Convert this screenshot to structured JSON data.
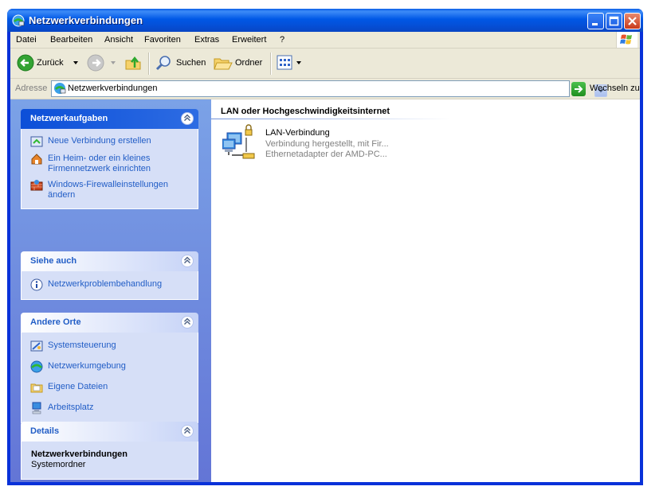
{
  "window": {
    "title": "Netzwerkverbindungen"
  },
  "menubar": {
    "items": [
      "Datei",
      "Bearbeiten",
      "Ansicht",
      "Favoriten",
      "Extras",
      "Erweitert",
      "?"
    ]
  },
  "toolbar": {
    "back_label": "Zurück",
    "search_label": "Suchen",
    "folders_label": "Ordner"
  },
  "addressbar": {
    "label": "Adresse",
    "value": "Netzwerkverbindungen",
    "go_label": "Wechseln zu"
  },
  "sidebar": {
    "network_tasks": {
      "title": "Netzwerkaufgaben",
      "items": [
        {
          "label": "Neue Verbindung erstellen",
          "icon": "new-connection-icon"
        },
        {
          "label": "Ein Heim- oder ein kleines Firmennetzwerk einrichten",
          "icon": "home-network-icon"
        },
        {
          "label": "Windows-Firewalleinstellungen ändern",
          "icon": "firewall-icon"
        }
      ]
    },
    "see_also": {
      "title": "Siehe auch",
      "items": [
        {
          "label": "Netzwerkproblembehandlung",
          "icon": "info-icon"
        }
      ]
    },
    "other_places": {
      "title": "Andere Orte",
      "items": [
        {
          "label": "Systemsteuerung",
          "icon": "control-panel-icon"
        },
        {
          "label": "Netzwerkumgebung",
          "icon": "network-places-icon"
        },
        {
          "label": "Eigene Dateien",
          "icon": "my-documents-icon"
        },
        {
          "label": "Arbeitsplatz",
          "icon": "my-computer-icon"
        }
      ]
    },
    "details": {
      "title": "Details",
      "name": "Netzwerkverbindungen",
      "type": "Systemordner"
    }
  },
  "main": {
    "group_title": "LAN oder Hochgeschwindigkeitsinternet",
    "connections": [
      {
        "name": "LAN-Verbindung",
        "status": "Verbindung hergestellt, mit Fir...",
        "adapter": "Ethernetadapter der AMD-PC..."
      }
    ]
  },
  "colors": {
    "titlebar": "#0058e6",
    "sidebar_link": "#215dc6",
    "sidebar_bg": "#7ba2e7",
    "panel_body": "#d6dff7"
  }
}
